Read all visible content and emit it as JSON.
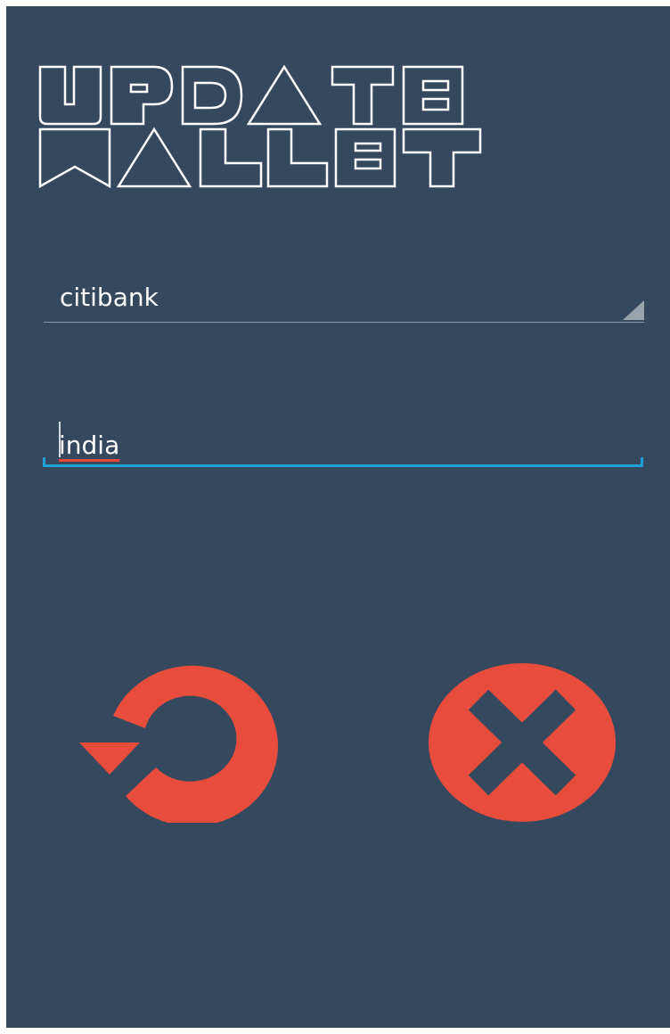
{
  "header": {
    "title": "UPDATE WALLET"
  },
  "form": {
    "bank_select": {
      "selected": "citibank"
    },
    "country_field": {
      "value": "india"
    }
  },
  "actions": {
    "undo_icon": "undo-icon",
    "cancel_icon": "close-icon"
  },
  "colors": {
    "background": "#35495e",
    "accent_red": "#e74c3c",
    "field_focus": "#1f9fd6",
    "text": "#ffffff"
  }
}
